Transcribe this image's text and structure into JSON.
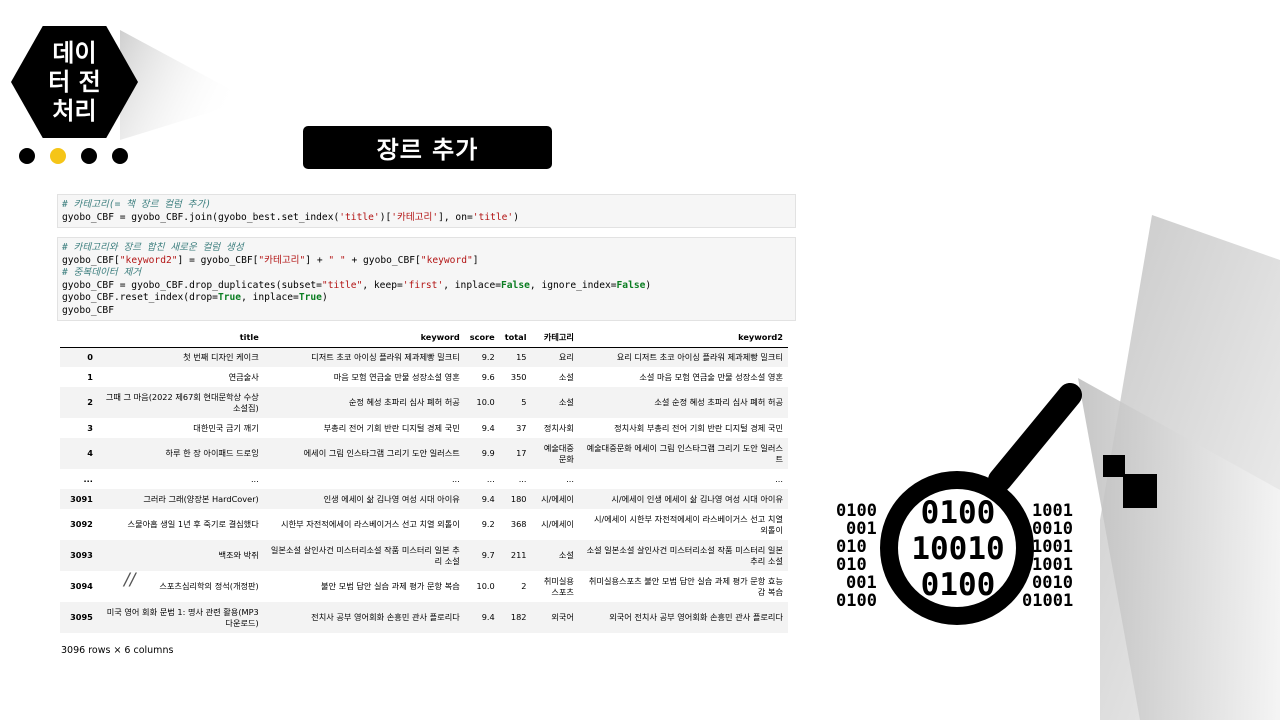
{
  "badge": {
    "text": "데이터 전처리"
  },
  "title": "장르 추가",
  "code_cells": {
    "cell1": {
      "line1": "# 카테고리(= 책 장르 컬럼 추가)",
      "line2_a": "gyobo_CBF = gyobo_CBF.join(gyobo_best.set_index(",
      "line2_s1": "'title'",
      "line2_b": ")[",
      "line2_s2": "'카테고리'",
      "line2_c": "], on=",
      "line2_s3": "'title'",
      "line2_d": ")"
    },
    "cell2": {
      "line1": "# 카테고리와 장르 합친 새로운 컬럼 생성",
      "line2_a": "gyobo_CBF[",
      "line2_s1": "\"keyword2\"",
      "line2_b": "] = gyobo_CBF[",
      "line2_s2": "\"카테고리\"",
      "line2_c": "] + ",
      "line2_s3": "\" \"",
      "line2_d": " + gyobo_CBF[",
      "line2_s4": "\"keyword\"",
      "line2_e": "]",
      "line3": "# 중복데이터 제거",
      "line4_a": "gyobo_CBF = gyobo_CBF.drop_duplicates(subset=",
      "line4_s1": "\"title\"",
      "line4_b": ", keep=",
      "line4_s2": "'first'",
      "line4_c": ", inplace=",
      "line4_k1": "False",
      "line4_d": ", ignore_index=",
      "line4_k2": "False",
      "line4_e": ")",
      "line5_a": "gyobo_CBF.reset_index(drop=",
      "line5_k1": "True",
      "line5_b": ", inplace=",
      "line5_k2": "True",
      "line5_c": ")",
      "line6": "gyobo_CBF"
    }
  },
  "table": {
    "columns": [
      "title",
      "keyword",
      "score",
      "total",
      "카테고리",
      "keyword2"
    ],
    "rows": [
      {
        "idx": "0",
        "title": "첫 번째 디자인 케이크",
        "keyword": "디저트 초코 아이싱 플라워 제과제빵 밀크티",
        "score": "9.2",
        "total": "15",
        "cat": "요리",
        "kw2": "요리 디저트 초코 아이싱 플라워 제과제빵 밀크티"
      },
      {
        "idx": "1",
        "title": "연금술사",
        "keyword": "마음 모험 연금술 만물 성장소설 영혼",
        "score": "9.6",
        "total": "350",
        "cat": "소설",
        "kw2": "소설 마음 모험 연금술 만물 성장소설 영혼"
      },
      {
        "idx": "2",
        "title": "그때 그 마음(2022 제67회 현대문학상 수상소설집)",
        "keyword": "순정 혜성 초파리 심사 폐허 허공",
        "score": "10.0",
        "total": "5",
        "cat": "소설",
        "kw2": "소설 순정 혜성 초파리 심사 폐허 허공"
      },
      {
        "idx": "3",
        "title": "대한민국 금기 깨기",
        "keyword": "부총리 전어 기회 반란 디지털 경제 국민",
        "score": "9.4",
        "total": "37",
        "cat": "정치사회",
        "kw2": "정치사회 부총리 전어 기회 반란 디지털 경제 국민"
      },
      {
        "idx": "4",
        "title": "하루 한 장 아이패드 드로잉",
        "keyword": "에세이 그림 인스타그램 그리기 도안 일러스트",
        "score": "9.9",
        "total": "17",
        "cat": "예술대중문화",
        "kw2": "예술대중문화 에세이 그림 인스타그램 그리기 도안 일러스트"
      },
      {
        "idx": "...",
        "title": "...",
        "keyword": "...",
        "score": "...",
        "total": "...",
        "cat": "...",
        "kw2": "..."
      },
      {
        "idx": "3091",
        "title": "그러라 그래(양장본 HardCover)",
        "keyword": "인생 에세이 삶 김나영 여성 시대 아이유",
        "score": "9.4",
        "total": "180",
        "cat": "시/에세이",
        "kw2": "시/에세이 인생 에세이 삶 김나영 여성 시대 아이유"
      },
      {
        "idx": "3092",
        "title": "스물아홉 생일 1년 후 죽기로 결심했다",
        "keyword": "시한부 자전적에세이 라스베이거스 선고 치열 외톨이",
        "score": "9.2",
        "total": "368",
        "cat": "시/에세이",
        "kw2": "시/에세이 시한부 자전적에세이 라스베이거스 선고 치열 외톨이"
      },
      {
        "idx": "3093",
        "title": "백조와 박쥐",
        "keyword": "일본소설 살인사건 미스터리소설 작품 미스터리 일본 추리 소설",
        "score": "9.7",
        "total": "211",
        "cat": "소설",
        "kw2": "소설 일본소설 살인사건 미스터리소설 작품 미스터리 일본 추리 소설"
      },
      {
        "idx": "3094",
        "title": "스포츠심리학의 정석(개정판)",
        "keyword": "불안 모범 답안 실습 과제 평가 문항 복습",
        "score": "10.0",
        "total": "2",
        "cat": "취미실용스포츠",
        "kw2": "취미실용스포츠 불안 모범 답안 실습 과제 평가 문항 효능감 복습"
      },
      {
        "idx": "3095",
        "title": "미국 영어 회화 문법 1: 명사 관련 활용(MP3 다운로드)",
        "keyword": "전치사 공부 영어회화 손흥민 관사 플로리다",
        "score": "9.4",
        "total": "182",
        "cat": "외국어",
        "kw2": "외국어 전치사 공부 영어회화 손흥민 관사 플로리다"
      }
    ],
    "footer": "3096 rows × 6 columns"
  },
  "decor": {
    "slash": "//",
    "binary_lines": [
      "0100",
      "001",
      "010",
      "010",
      "001",
      "0100"
    ],
    "binary_right": [
      "1001",
      "0010",
      "1001",
      "1001",
      "0010",
      "01001"
    ],
    "lens_lines": [
      "0100",
      "10010",
      "0100"
    ],
    "colors": {
      "accent_dot": "#f5c518",
      "ink": "#000000"
    }
  }
}
